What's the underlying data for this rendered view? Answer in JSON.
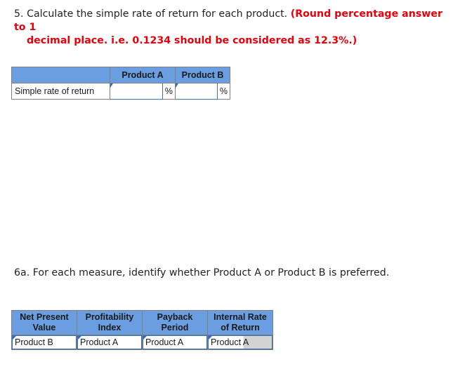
{
  "question5": {
    "number": "5.",
    "text": "Calculate the simple rate of return for each product.",
    "instruction_line1": "(Round percentage answer to 1",
    "instruction_line2": "decimal place. i.e. 0.1234 should be considered as 12.3%.)"
  },
  "rate_table": {
    "headers": [
      "",
      "Product A",
      "Product B"
    ],
    "row_label": "Simple rate of return",
    "inputs": [
      {
        "product": "Product A",
        "value": "",
        "unit": "%"
      },
      {
        "product": "Product B",
        "value": "",
        "unit": "%"
      }
    ]
  },
  "question6a": {
    "text": "6a. For each measure, identify whether Product A or Product B is preferred."
  },
  "preference_table": {
    "headers": [
      {
        "line1": "Net Present",
        "line2": "Value"
      },
      {
        "line1": "Profitability",
        "line2": "Index"
      },
      {
        "line1": "Payback",
        "line2": "Period"
      },
      {
        "line1": "Internal Rate",
        "line2": "of Return"
      }
    ],
    "selections": [
      "Product B",
      "Product A",
      "Product A",
      "Product A"
    ]
  },
  "colors": {
    "header_bg": "#6a9ee0",
    "instruction_red": "#e8000b",
    "input_border": "#3a70b5"
  }
}
